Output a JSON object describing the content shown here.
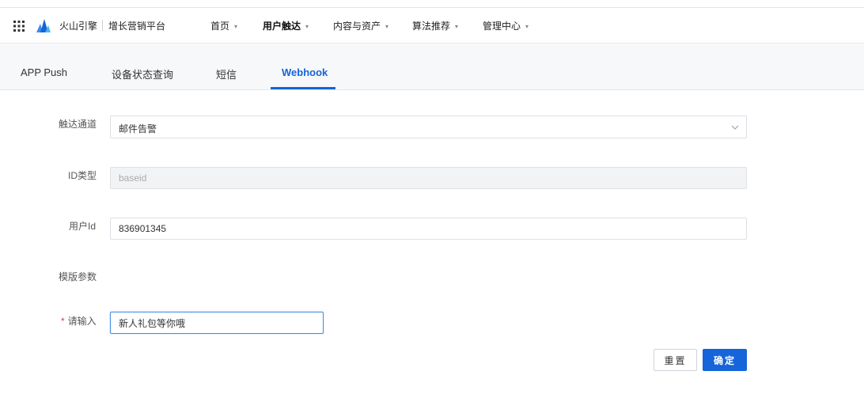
{
  "header": {
    "brand": "火山引擎",
    "platform": "增长营销平台",
    "nav": [
      {
        "label": "首页",
        "active": false
      },
      {
        "label": "用户触达",
        "active": true
      },
      {
        "label": "内容与资产",
        "active": false
      },
      {
        "label": "算法推荐",
        "active": false
      },
      {
        "label": "管理中心",
        "active": false
      }
    ],
    "caret": "▾"
  },
  "tabs": [
    {
      "label": "APP Push",
      "active": false
    },
    {
      "label": "设备状态查询",
      "active": false
    },
    {
      "label": "短信",
      "active": false
    },
    {
      "label": "Webhook",
      "active": true
    }
  ],
  "form": {
    "channel": {
      "label": "触达通道",
      "value": "邮件告警"
    },
    "id_type": {
      "label": "ID类型",
      "value": "baseid"
    },
    "user_id": {
      "label": "用户Id",
      "value": "836901345"
    },
    "template_params": {
      "label": "模版参数"
    },
    "input": {
      "required_mark": "*",
      "label": "请输入",
      "value": "新人礼包等你哦"
    }
  },
  "buttons": {
    "reset": "重置",
    "confirm": "确定"
  },
  "colors": {
    "accent": "#1664d9",
    "required": "#e53935"
  }
}
